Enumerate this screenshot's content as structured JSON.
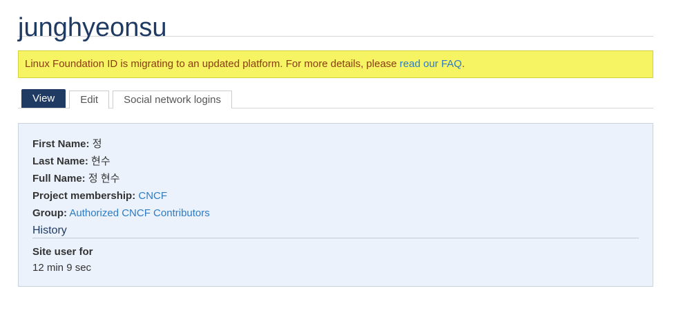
{
  "page": {
    "title": "junghyeonsu"
  },
  "notice": {
    "text": "Linux Foundation ID is migrating to an updated platform. For more details, please ",
    "link_text": "read our FAQ",
    "suffix": "."
  },
  "tabs": [
    {
      "label": "View",
      "active": true
    },
    {
      "label": "Edit",
      "active": false
    },
    {
      "label": "Social network logins",
      "active": false
    }
  ],
  "profile": {
    "first_name_label": "First Name:",
    "first_name_value": "정",
    "last_name_label": "Last Name:",
    "last_name_value": "현수",
    "full_name_label": "Full Name:",
    "full_name_value": "정 현수",
    "project_label": "Project membership:",
    "project_value": "CNCF",
    "group_label": "Group:",
    "group_value": "Authorized CNCF Contributors"
  },
  "history": {
    "title": "History",
    "site_user_label": "Site user for",
    "site_user_value": "12 min 9 sec"
  },
  "colors": {
    "title": "#1f3a63",
    "notice_bg": "#f7f464",
    "notice_text": "#8a3b12",
    "link": "#2e7bc4",
    "active_tab_bg": "#1f3a63",
    "profile_bg": "#ebf2fc"
  }
}
